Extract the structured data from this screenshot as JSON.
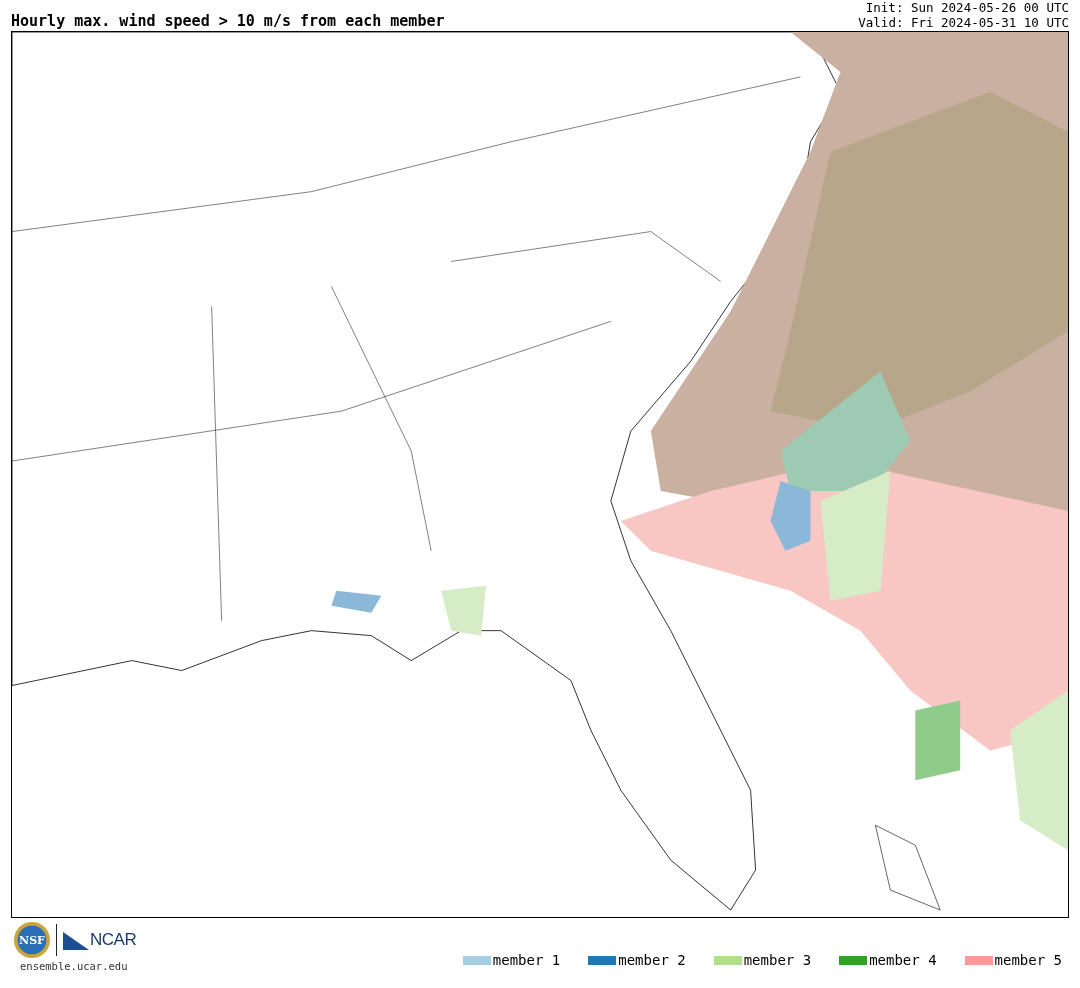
{
  "title": "Hourly max. wind speed > 10 m/s from each member",
  "init": "Init: Sun 2024-05-26 00 UTC",
  "valid": "Valid: Fri 2024-05-31 10 UTC",
  "logos": {
    "nsf": "NSF",
    "ncar": "NCAR",
    "site": "ensemble.ucar.edu"
  },
  "legend": [
    {
      "label": "member 1",
      "color": "#a6cee3"
    },
    {
      "label": "member 2",
      "color": "#1f78b4"
    },
    {
      "label": "member 3",
      "color": "#b2df8a"
    },
    {
      "label": "member 4",
      "color": "#33a02c"
    },
    {
      "label": "member 5",
      "color": "#fb9a99"
    }
  ]
}
